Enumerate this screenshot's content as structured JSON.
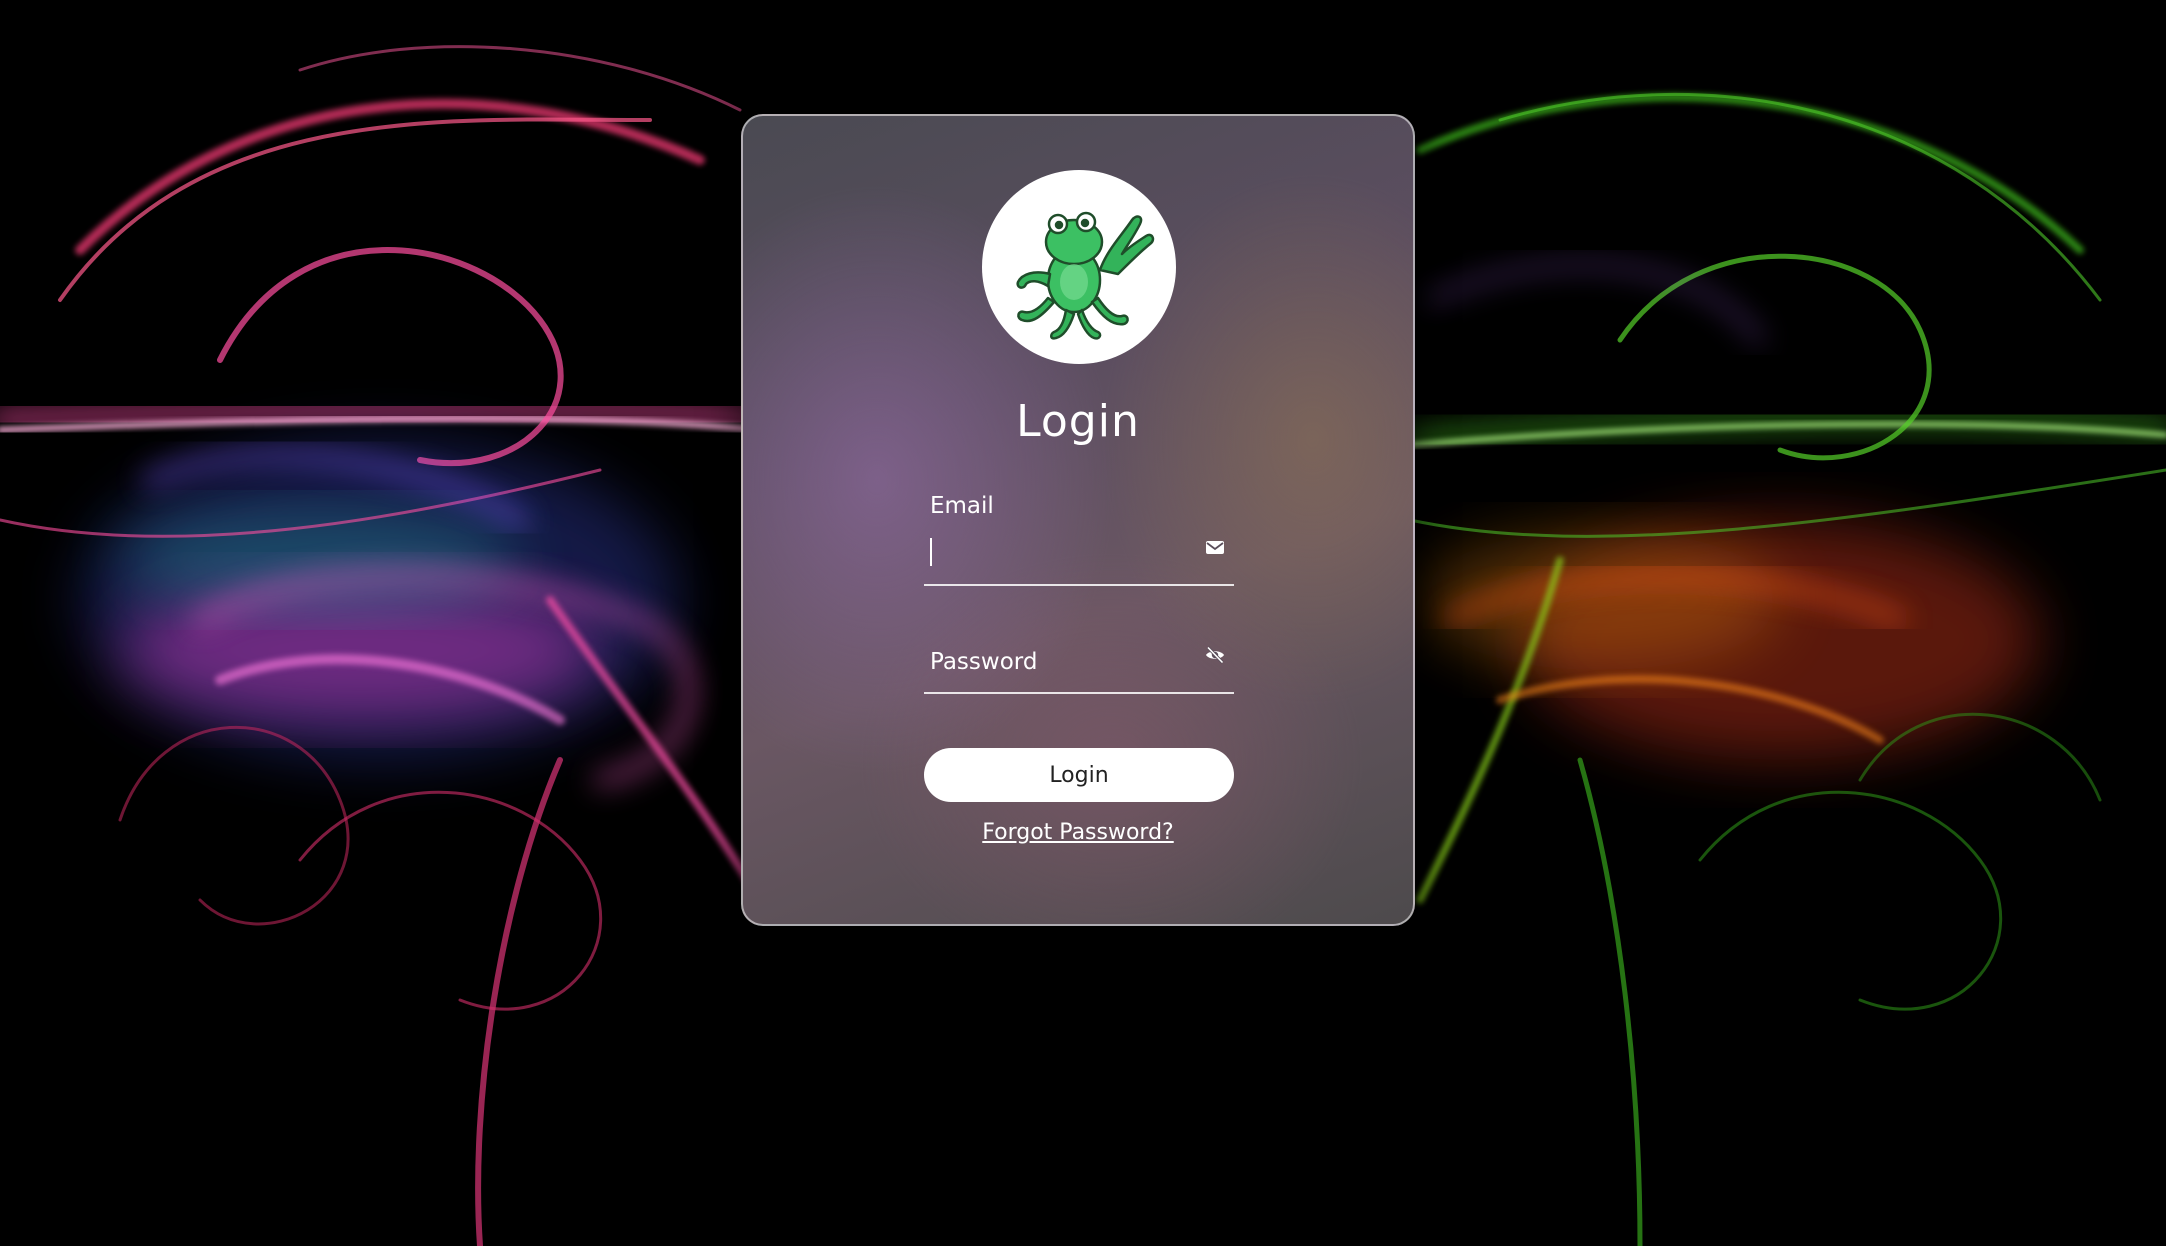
{
  "login": {
    "title": "Login",
    "email_label": "Email",
    "email_value": "",
    "password_label": "Password",
    "password_value": "",
    "submit_label": "Login",
    "forgot_label": "Forgot Password?"
  },
  "icons": {
    "logo": "frog-logo",
    "email": "envelope-icon",
    "password": "eye-slash-icon"
  },
  "colors": {
    "background": "#000000",
    "left_swirl": "#ff3d8b",
    "right_swirl": "#3fbf1f",
    "button": "#ffffff",
    "text": "#ffffff",
    "logo_green": "#33b35a"
  }
}
